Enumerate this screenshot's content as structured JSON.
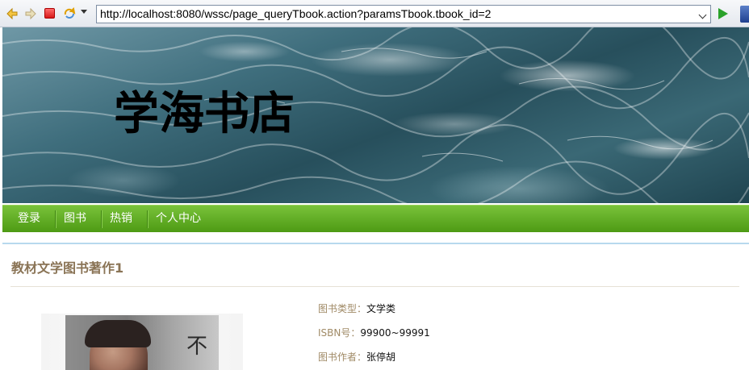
{
  "browser": {
    "url": "http://localhost:8080/wssc/page_queryTbook.action?paramsTbook.tbook_id=2",
    "icons": {
      "back": "back-arrow-icon",
      "forward": "forward-arrow-icon",
      "stop": "stop-icon",
      "refresh": "refresh-icon",
      "go": "go-icon"
    }
  },
  "site": {
    "title": "学海书店"
  },
  "nav": {
    "items": [
      {
        "label": "登录"
      },
      {
        "label": "图书"
      },
      {
        "label": "热销"
      },
      {
        "label": "个人中心"
      }
    ]
  },
  "book": {
    "title": "教材文学图书著作1",
    "cover_text": "不",
    "details": [
      {
        "label": "图书类型：",
        "value": "文学类"
      },
      {
        "label": "ISBN号：",
        "value": "99900~99991"
      },
      {
        "label": "图书作者：",
        "value": "张停胡"
      }
    ]
  },
  "colors": {
    "nav_green": "#5fae25",
    "title_brown": "#8a7456",
    "label_tan": "#a08a66",
    "content_border": "#b7d9ee"
  }
}
